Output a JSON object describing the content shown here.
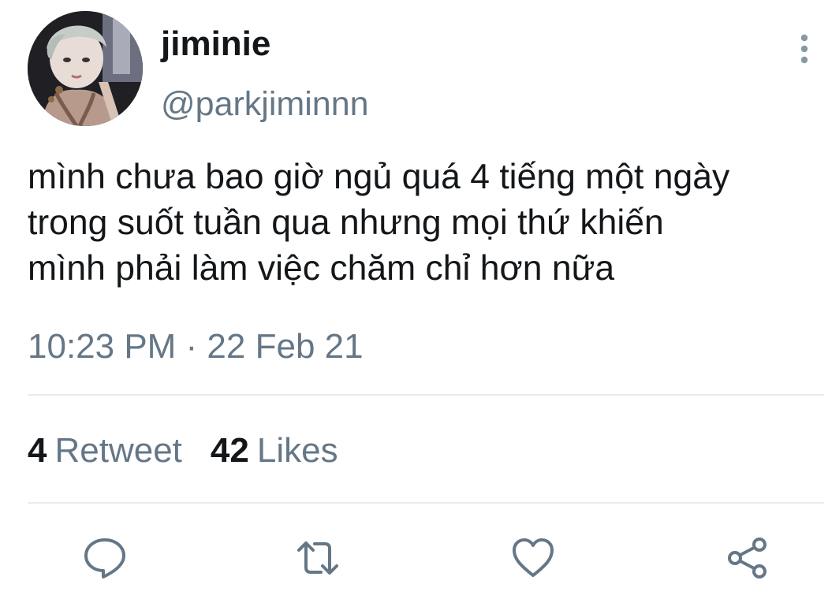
{
  "user": {
    "display_name": "jiminie",
    "handle": "@parkjiminnn",
    "avatar_icon": "profile-photo"
  },
  "tweet": {
    "lines": [
      "mình chưa bao giờ ngủ quá 4 tiếng một ngày",
      "trong suốt tuần qua nhưng mọi thứ khiến",
      "mình phải làm việc chăm chỉ hơn nữa"
    ],
    "timestamp": "10:23 PM · 22 Feb 21"
  },
  "stats": {
    "retweets": {
      "count": "4",
      "label": "Retweet"
    },
    "likes": {
      "count": "42",
      "label": "Likes"
    }
  },
  "actions": {
    "reply_icon": "reply-icon",
    "retweet_icon": "retweet-icon",
    "like_icon": "heart-icon",
    "share_icon": "share-icon",
    "more_icon": "more-vertical-icon"
  },
  "colors": {
    "text_primary": "#14171a",
    "text_secondary": "#657786",
    "divider": "#e6ecf0"
  }
}
